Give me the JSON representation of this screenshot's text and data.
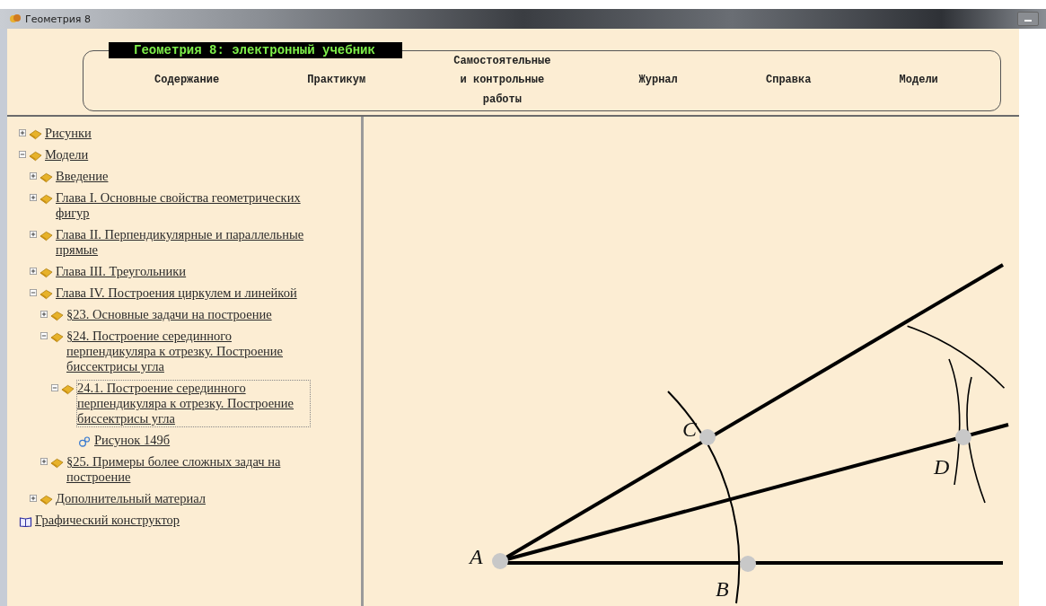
{
  "window": {
    "title": "Геометрия 8"
  },
  "header": {
    "title": "Геометрия 8: электронный учебник"
  },
  "nav": [
    {
      "label": "Содержание"
    },
    {
      "label": "Практикум"
    },
    {
      "label": "Самостоятельные\nи контрольные\nработы"
    },
    {
      "label": "Журнал"
    },
    {
      "label": "Справка"
    },
    {
      "label": "Модели"
    }
  ],
  "tree": [
    {
      "label": "Рисунки",
      "kind": "book",
      "expanded": false,
      "selected": false
    },
    {
      "label": "Модели",
      "kind": "book",
      "expanded": true,
      "selected": false,
      "children": [
        {
          "label": "Введение",
          "kind": "book",
          "expanded": false,
          "selected": false
        },
        {
          "label": "Глава I. Основные свойства геометрических фигур",
          "kind": "book",
          "expanded": false,
          "selected": false
        },
        {
          "label": "Глава II. Перпендикулярные и параллельные прямые",
          "kind": "book",
          "expanded": false,
          "selected": false
        },
        {
          "label": "Глава III. Треугольники",
          "kind": "book",
          "expanded": false,
          "selected": false
        },
        {
          "label": "Глава IV. Построения циркулем и линейкой",
          "kind": "book",
          "expanded": true,
          "selected": false,
          "children": [
            {
              "label": "§23. Основные задачи на построение",
              "kind": "book",
              "expanded": false,
              "selected": false
            },
            {
              "label": "§24. Построение серединного перпендикуляра к отрезку. Построение биссектрисы угла",
              "kind": "book",
              "expanded": true,
              "selected": false,
              "children": [
                {
                  "label": "24.1. Построение серединного перпендикуляра к отрезку. Построение биссектрисы угла",
                  "kind": "book",
                  "expanded": true,
                  "selected": true,
                  "children": [
                    {
                      "label": "Рисунок 149б",
                      "kind": "model",
                      "selected": false
                    }
                  ]
                }
              ]
            },
            {
              "label": "§25. Примеры более сложных задач на построение",
              "kind": "book",
              "expanded": false,
              "selected": false
            }
          ]
        },
        {
          "label": "Дополнительный материал",
          "kind": "book",
          "expanded": false,
          "selected": false
        }
      ]
    },
    {
      "label": "Графический конструктор",
      "kind": "tool",
      "selected": false
    }
  ],
  "drawing": {
    "points": [
      {
        "label": "A"
      },
      {
        "label": "B"
      },
      {
        "label": "C"
      },
      {
        "label": "D"
      }
    ]
  }
}
